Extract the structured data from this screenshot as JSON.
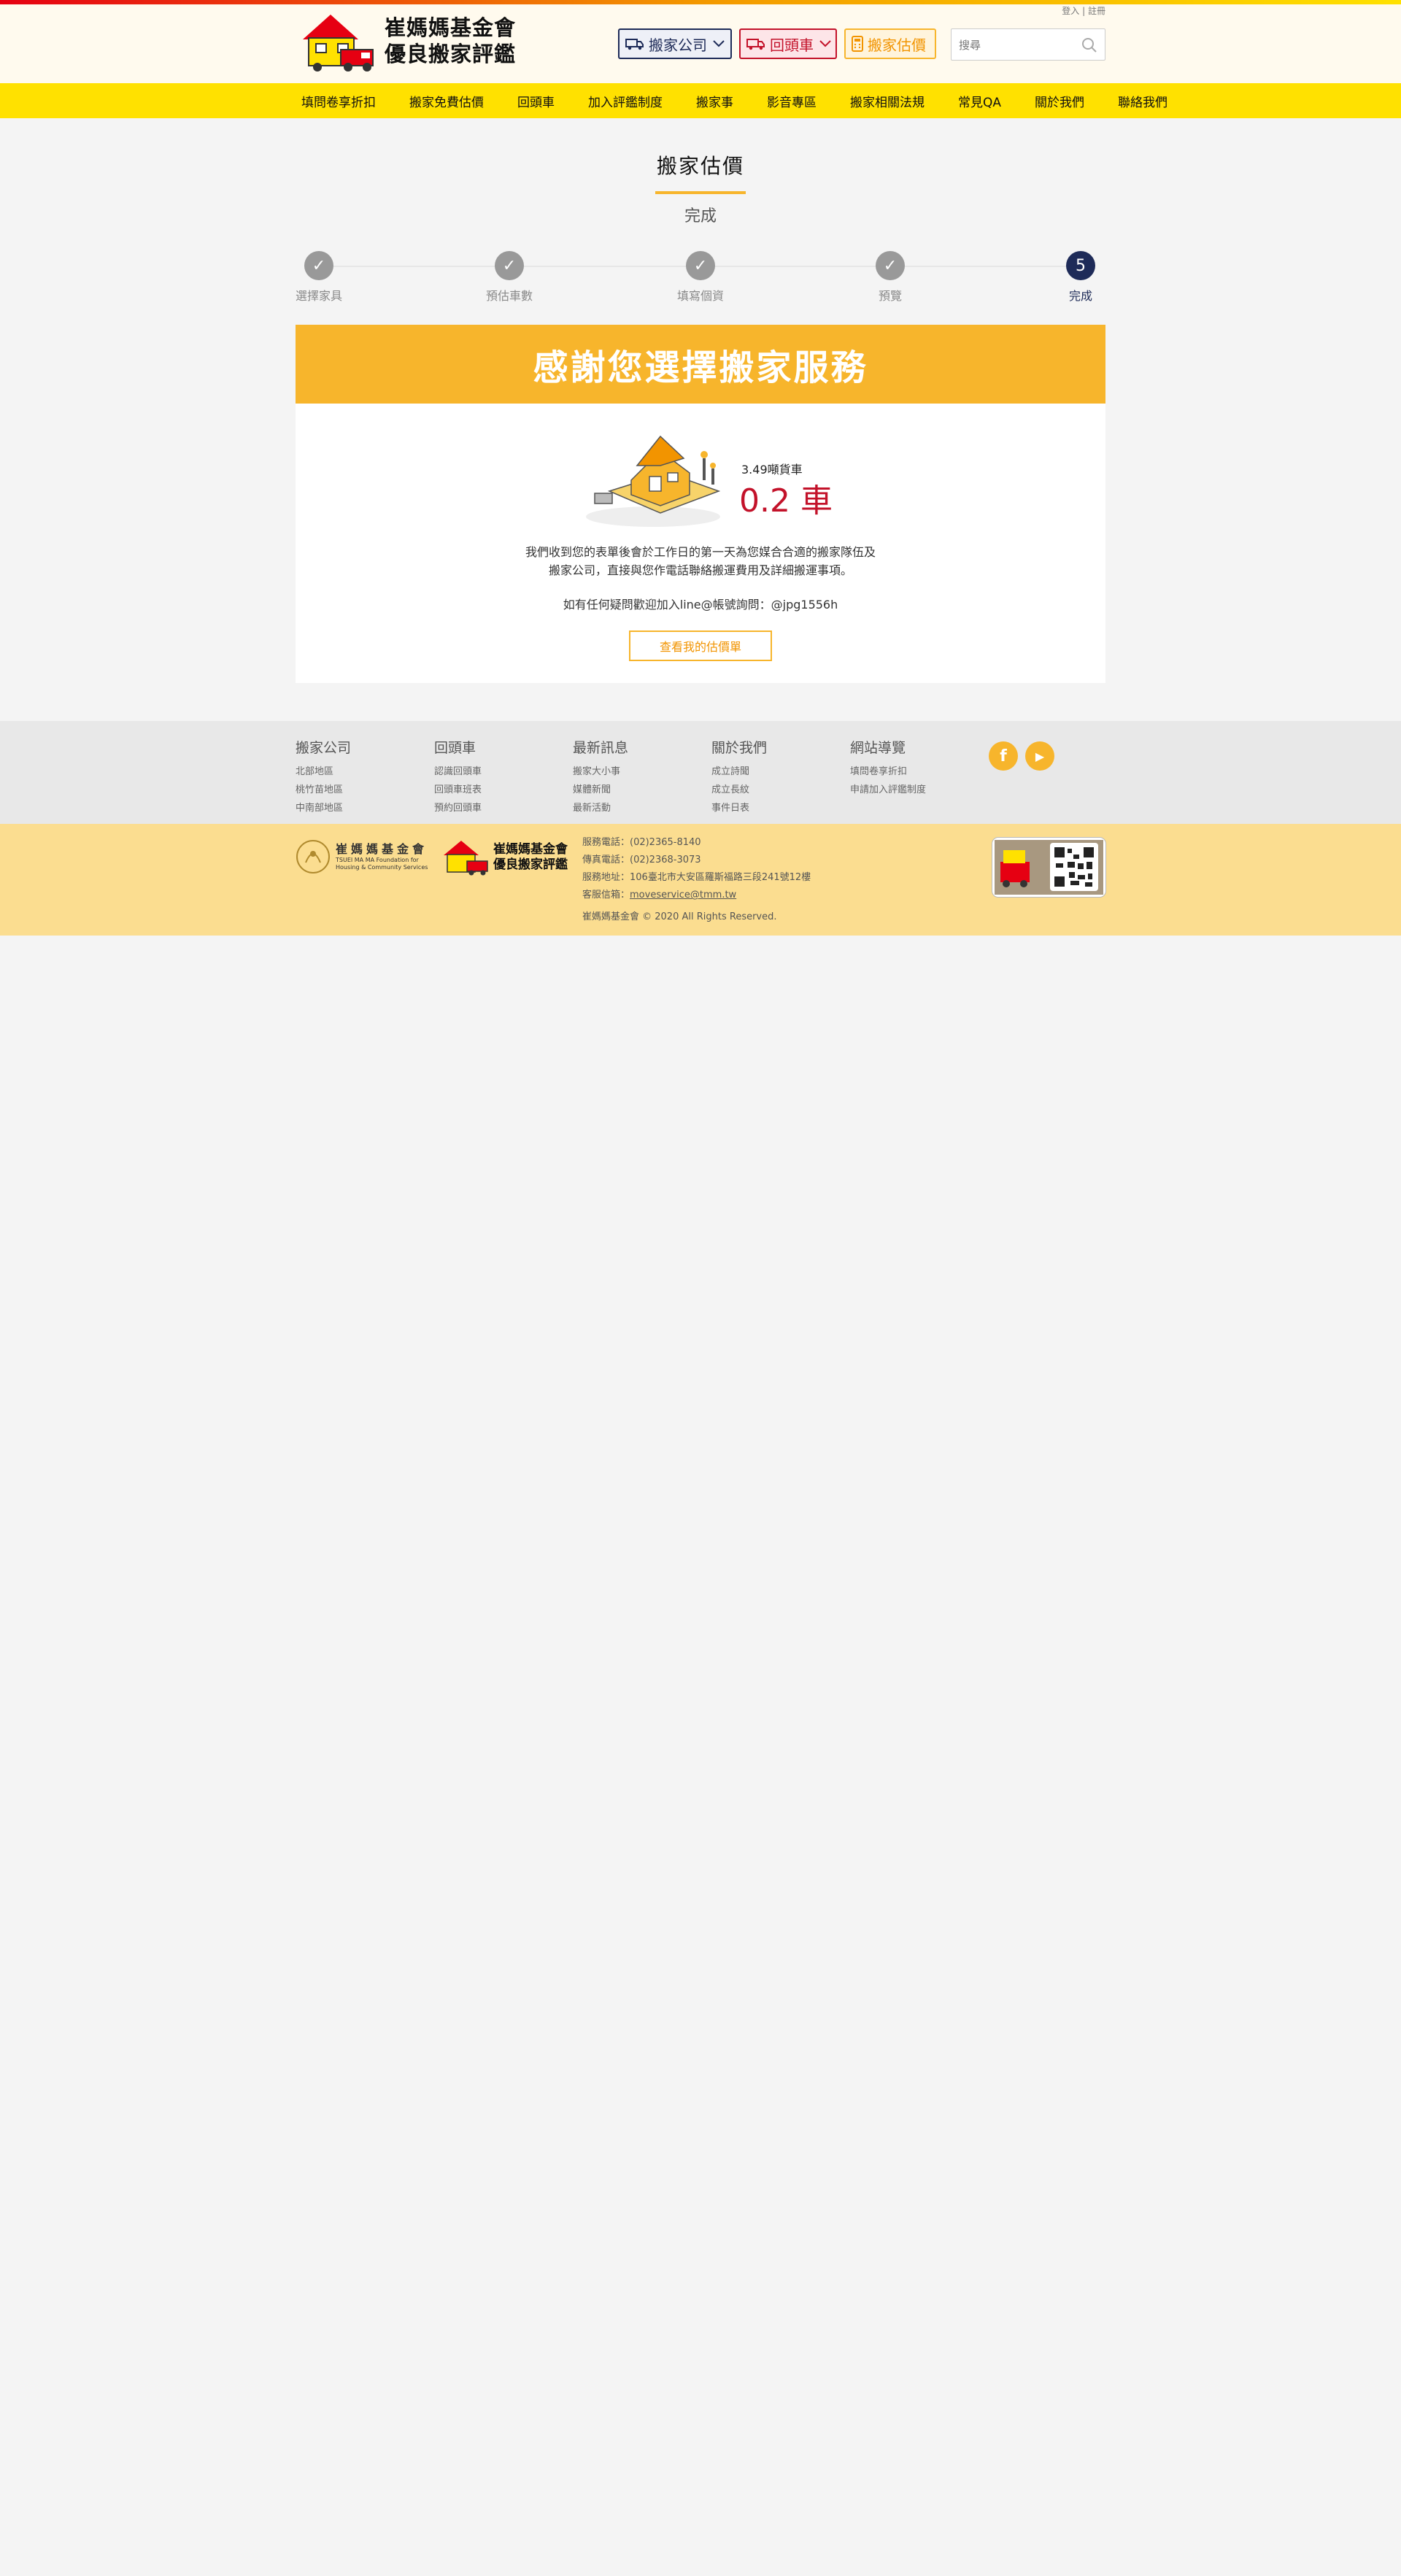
{
  "header": {
    "logo_line1": "崔媽媽基金會",
    "logo_line2": "優良搬家評鑑",
    "login": "登入",
    "separator": "|",
    "register": "註冊",
    "btn_company": "搬家公司",
    "btn_return": "回頭車",
    "btn_estimate": "搬家估價",
    "search_placeholder": "搜尋"
  },
  "nav": {
    "items": [
      "填問卷享折扣",
      "搬家免費估價",
      "回頭車",
      "加入評鑑制度",
      "搬家事",
      "影音專區",
      "搬家相關法規",
      "常見QA",
      "關於我們",
      "聯絡我們"
    ]
  },
  "page": {
    "title": "搬家估價",
    "subtitle": "完成"
  },
  "steps": [
    {
      "label": "選擇家具",
      "mark": "✓"
    },
    {
      "label": "預估車數",
      "mark": "✓"
    },
    {
      "label": "填寫個資",
      "mark": "✓"
    },
    {
      "label": "預覽",
      "mark": "✓"
    },
    {
      "label": "完成",
      "mark": "5"
    }
  ],
  "result": {
    "banner": "感謝您選擇搬家服務",
    "truck_type": "3.49噸貨車",
    "truck_count": "0.2 車",
    "message_line1": "我們收到您的表單後會於工作日的第一天為您媒合合適的搬家隊伍及",
    "message_line2": "搬家公司，直接與您作電話聯絡搬運費用及詳細搬運事項。",
    "line_contact": "如有任何疑問歡迎加入line@帳號詢問：@jpg1556h",
    "view_button": "查看我的估價單"
  },
  "footer": {
    "columns": [
      {
        "title": "搬家公司",
        "links": [
          "北部地區",
          "桃竹苗地區",
          "中南部地區"
        ]
      },
      {
        "title": "回頭車",
        "links": [
          "認識回頭車",
          "回頭車班表",
          "預約回頭車"
        ]
      },
      {
        "title": "最新訊息",
        "links": [
          "搬家大小事",
          "媒體新聞",
          "最新活動"
        ]
      },
      {
        "title": "關於我們",
        "links": [
          "成立詩聞",
          "成立長紋",
          "事件日表"
        ]
      },
      {
        "title": "網站導覽",
        "links": [
          "填問卷享折扣",
          "申請加入評鑑制度"
        ]
      }
    ],
    "social": {
      "facebook": "f",
      "youtube": "▶"
    },
    "org_name": "崔媽媽基金會",
    "org_en_line1": "TSUEI MA MA Foundation for",
    "org_en_line2": "Housing & Community Services",
    "brand_line1": "崔媽媽基金會",
    "brand_line2": "優良搬家評鑑",
    "phone": "服務電話：(02)2365-8140",
    "fax": "傳真電話：(02)2368-3073",
    "address": "服務地址：106臺北市大安區羅斯福路三段241號12樓",
    "email_label": "客服信箱：",
    "email": "moveservice@tmm.tw",
    "copyright": "崔媽媽基金會 © 2020 All Rights Reserved."
  },
  "colors": {
    "yellow_nav": "#ffe100",
    "accent": "#f7b52c",
    "navy": "#1e2b58",
    "red": "#c3122a"
  }
}
